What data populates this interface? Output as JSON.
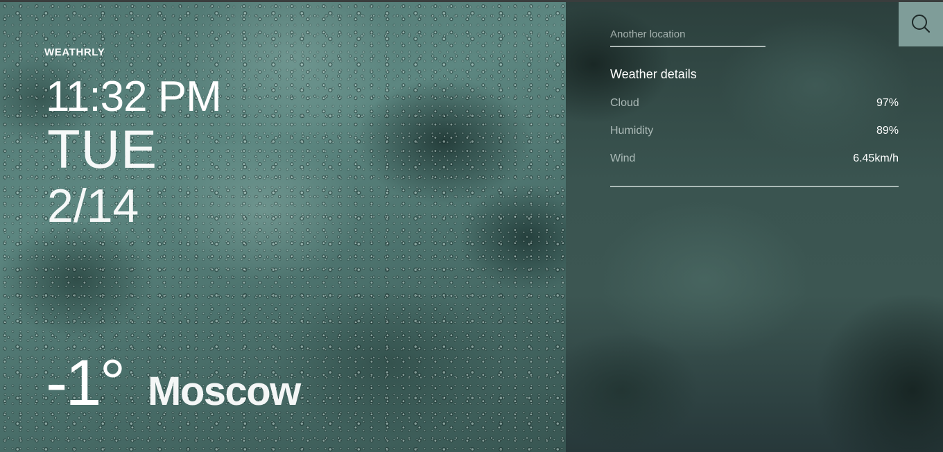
{
  "app": {
    "brand": "WEATHRLY"
  },
  "clock": {
    "time": "11:32 PM",
    "day": "TUE",
    "date": "2/14"
  },
  "current": {
    "temperature": "-1°",
    "city": "Moscow"
  },
  "search": {
    "placeholder": "Another location",
    "value": "",
    "icon": "search-icon"
  },
  "details": {
    "title": "Weather details",
    "rows": [
      {
        "label": "Cloud",
        "value": "97%"
      },
      {
        "label": "Humidity",
        "value": "89%"
      },
      {
        "label": "Wind",
        "value": "6.45km/h"
      }
    ]
  },
  "colors": {
    "search_button_bg": "#7f9d99",
    "text_primary": "#ffffff",
    "text_secondary": "#cdd8d6"
  }
}
